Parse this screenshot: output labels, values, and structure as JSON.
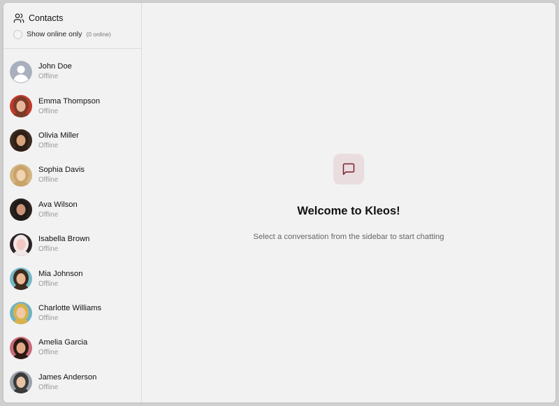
{
  "sidebar": {
    "title": "Contacts",
    "title_icon": "users-icon",
    "online_filter_label": "Show online only",
    "online_count": "(0 online)",
    "contacts": [
      {
        "name": "John Doe",
        "status": "Offline",
        "avatar": "default"
      },
      {
        "name": "Emma Thompson",
        "status": "Offline",
        "avatar": "photo"
      },
      {
        "name": "Olivia Miller",
        "status": "Offline",
        "avatar": "photo"
      },
      {
        "name": "Sophia Davis",
        "status": "Offline",
        "avatar": "photo"
      },
      {
        "name": "Ava Wilson",
        "status": "Offline",
        "avatar": "photo"
      },
      {
        "name": "Isabella Brown",
        "status": "Offline",
        "avatar": "photo"
      },
      {
        "name": "Mia Johnson",
        "status": "Offline",
        "avatar": "photo"
      },
      {
        "name": "Charlotte Williams",
        "status": "Offline",
        "avatar": "photo"
      },
      {
        "name": "Amelia Garcia",
        "status": "Offline",
        "avatar": "photo"
      },
      {
        "name": "James Anderson",
        "status": "Offline",
        "avatar": "photo"
      }
    ]
  },
  "main": {
    "icon": "message-square-icon",
    "title": "Welcome to Kleos!",
    "subtitle": "Select a conversation from the sidebar to start chatting"
  },
  "colors": {
    "background": "#f2f2f2",
    "accent_icon": "#7a1f2b",
    "accent_bg": "#eadde0",
    "status_text": "#9a9a9a"
  }
}
